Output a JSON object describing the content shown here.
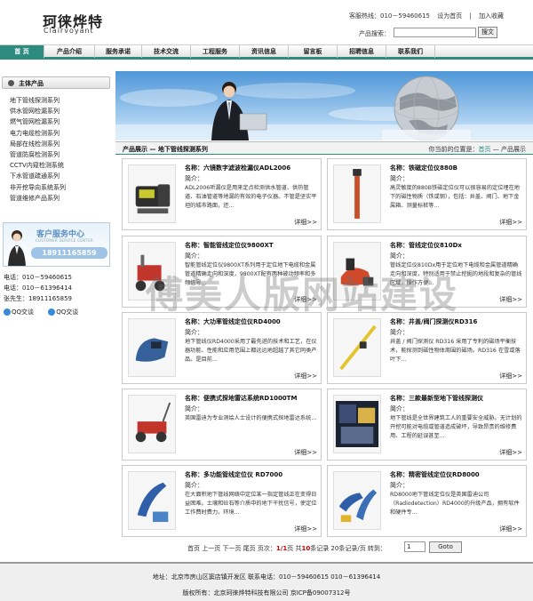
{
  "header": {
    "logo_cn": "珂徕烨特",
    "logo_en": "Clairvoyant",
    "hotline": "客服热线：010－59460615",
    "set_home": "设为首页",
    "sep": "|",
    "favorite": "加入收藏",
    "search_label": "产品搜索：",
    "search_value": "",
    "search_button": "搜文"
  },
  "nav": [
    "首 页",
    "产品介绍",
    "服务承诺",
    "技术交流",
    "工程服务",
    "资讯信息",
    "留言板",
    "招聘信息",
    "联系我们"
  ],
  "sidebar": {
    "title": "主体产品",
    "categories": [
      "地下管线探测系列",
      "供水管网检漏系列",
      "燃气管网检漏系列",
      "电力电缆检测系列",
      "局部在线检测系列",
      "管道防腐检测系列",
      "CCTV内窥检测系统",
      "下水管道疏通系列",
      "非开挖导向系统系列",
      "管道维修产品系列"
    ],
    "service_title": "客户服务中心",
    "service_sub": "CUSTOMER SERVICE CENTER",
    "service_phone": "18911165859",
    "contacts": [
      "电话：010－59460615",
      "电话：010－61396414",
      "张先生：18911165859"
    ],
    "qq": [
      "QQ交谈",
      "QQ交谈"
    ]
  },
  "crumb": {
    "left": "产品展示 — 地下管线探测系列",
    "right_prefix": "你当前的位置是：",
    "home": "首页",
    "sep": " — ",
    "current": "产品展示"
  },
  "products": [
    {
      "name": "名称：六镜数字滤波检漏仪ADL2006",
      "intro": "简介：",
      "desc": "ADL2006听漏仪是用来定点检测供水管道、供热管道、石油管道等地漏的有效的电子仪器。不管是坚实平坦的城市路面，还...",
      "more": "详细>>"
    },
    {
      "name": "名称：铁磁定位仪880B",
      "intro": "简介：",
      "desc": "高灵敏度的880B铁磁定位仪可以很容易的定位埋在地下的磁性物质（铁或钢），包括：井盖、阀门、地下金属箱、测量标桩等...",
      "more": "详细>>"
    },
    {
      "name": "名称：智能管线定位仪9800XT",
      "intro": "简介：",
      "desc": "智能管线定位仪9800XT系列用于定位地下电缆和金属管道精确走向和深度，9800XT配有两种被动频率和多频信号...",
      "more": "详细>>"
    },
    {
      "name": "名称：管线定位仪810Dx",
      "intro": "简介：",
      "desc": "管线定位仪810Dx用于定位地下电缆和金属管道精确走向和深度，特别适用于禁止挖掘的地段和复杂的管线区域，操作方便...",
      "more": "详细>>"
    },
    {
      "name": "名称：大功率管线定位仪RD4000",
      "intro": "简介：",
      "desc": "地下管线仪RD4000采用了最先进的技术和工艺，在仪器功能、性能和应用范围上都远远地超越了其它同类产品。是目前...",
      "more": "详细>>"
    },
    {
      "name": "名称：井盖/阀门探测仪RD316",
      "intro": "简介：",
      "desc": "井盖 / 阀门探测仪 RD316 采用了专利的磁场平衡技术，能探测到磁性物体周围的磁场。RD316 在雪或落叶下...",
      "more": "详细>>"
    },
    {
      "name": "名称：便携式探地雷达系统RD1000TM",
      "intro": "简介：",
      "desc": "英国雷迪为专业测绘人士设计的便携式探地雷达系统...",
      "more": "详细>>"
    },
    {
      "name": "名称：三款最新型地下管线探测仪",
      "intro": "简介：",
      "desc": "地下管线是全世界建筑工人的重要安全威胁。无计划的开挖可能对电缆或管道造成破坏，导致昂贵的维修费用、工程的延误甚至...",
      "more": "详细>>"
    },
    {
      "name": "名称：多功能管线定位仪 RD7000",
      "intro": "简介：",
      "desc": "在大面积地下管线网络中定位某一指定管线正在变得日益困难。土壤和砼石等介质中的地下干扰信号，使定位工作费时费力。环境...",
      "more": "详细>>"
    },
    {
      "name": "名称：精密管线定位仪RD8000",
      "intro": "简介：",
      "desc": "RD8000地下管线定位仪是英国雷迪公司（Radiodetection）RD4000的升级产品，拥有软件和硬件专...",
      "more": "详细>>"
    }
  ],
  "pager": {
    "text1": "首页 上一页 下一页 尾页 页次：",
    "page": "1/1",
    "text2": "页  共",
    "total": "10",
    "text3": "条记录 20条记录/页 转到：",
    "goto_value": "1",
    "go_button": "Goto"
  },
  "footer": {
    "address": "地址：北京市房山区窦店镇开发区  联系电话：010－59460615   010－61396414",
    "copyright": "版权所有：北京珂徕烨特科技有限公司  京ICP备09007312号"
  },
  "watermark": "傅美人版网站建设",
  "colors": {
    "accent": "#2e8b80",
    "price_red": "#cc0000",
    "link_blue": "#3b8ad8"
  }
}
